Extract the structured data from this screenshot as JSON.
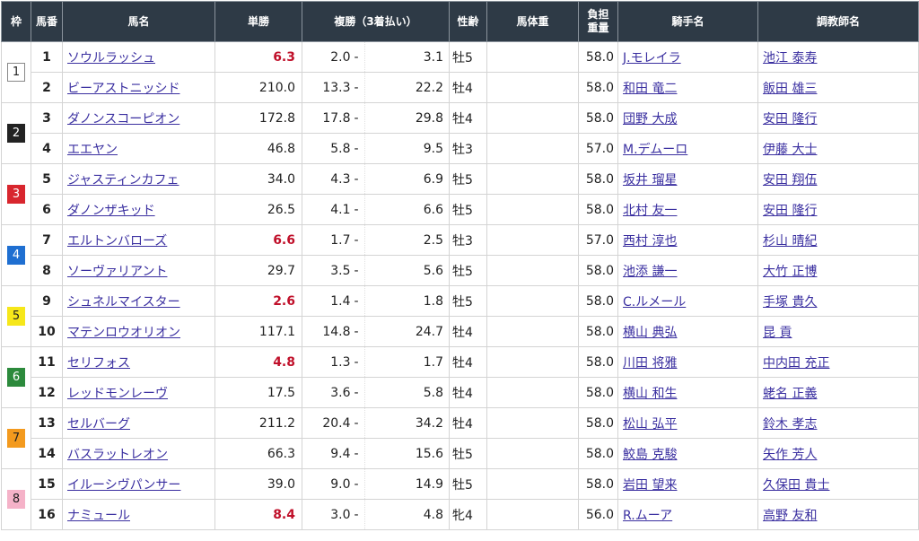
{
  "headers": {
    "waku": "枠",
    "umaban": "馬番",
    "horse": "馬名",
    "tansho": "単勝",
    "fukusho": "複勝（3着払い）",
    "sex_age": "性齢",
    "body_weight": "馬体重",
    "burden_line1": "負担",
    "burden_line2": "重量",
    "jockey": "騎手名",
    "trainer": "調教師名"
  },
  "waku_colors": {
    "1": {
      "bg": "#ffffff",
      "fg": "#222222"
    },
    "2": {
      "bg": "#222222",
      "fg": "#ffffff"
    },
    "3": {
      "bg": "#d8262e",
      "fg": "#ffffff"
    },
    "4": {
      "bg": "#1f6fd1",
      "fg": "#ffffff"
    },
    "5": {
      "bg": "#f6e71a",
      "fg": "#222222"
    },
    "6": {
      "bg": "#2c8a3c",
      "fg": "#ffffff"
    },
    "7": {
      "bg": "#f39a1e",
      "fg": "#222222"
    },
    "8": {
      "bg": "#f5b2c8",
      "fg": "#222222"
    }
  },
  "favorite_color": "#c0102a",
  "link_color": "#3a2fa0",
  "rows": [
    {
      "waku": "1",
      "umaban": "1",
      "horse": "ソウルラッシュ",
      "tansho": "6.3",
      "fav": true,
      "fuku_lo": "2.0",
      "sep": "-",
      "fuku_hi": "3.1",
      "sex_age": "牡5",
      "body_weight": "",
      "burden": "58.0",
      "jockey": "J.モレイラ",
      "trainer": "池江 泰寿"
    },
    {
      "waku": "1",
      "umaban": "2",
      "horse": "ビーアストニッシド",
      "tansho": "210.0",
      "fav": false,
      "fuku_lo": "13.3",
      "sep": "-",
      "fuku_hi": "22.2",
      "sex_age": "牡4",
      "body_weight": "",
      "burden": "58.0",
      "jockey": "和田 竜二",
      "trainer": "飯田 雄三"
    },
    {
      "waku": "2",
      "umaban": "3",
      "horse": "ダノンスコーピオン",
      "tansho": "172.8",
      "fav": false,
      "fuku_lo": "17.8",
      "sep": "-",
      "fuku_hi": "29.8",
      "sex_age": "牡4",
      "body_weight": "",
      "burden": "58.0",
      "jockey": "団野 大成",
      "trainer": "安田 隆行"
    },
    {
      "waku": "2",
      "umaban": "4",
      "horse": "エエヤン",
      "tansho": "46.8",
      "fav": false,
      "fuku_lo": "5.8",
      "sep": "-",
      "fuku_hi": "9.5",
      "sex_age": "牡3",
      "body_weight": "",
      "burden": "57.0",
      "jockey": "M.デムーロ",
      "trainer": "伊藤 大士"
    },
    {
      "waku": "3",
      "umaban": "5",
      "horse": "ジャスティンカフェ",
      "tansho": "34.0",
      "fav": false,
      "fuku_lo": "4.3",
      "sep": "-",
      "fuku_hi": "6.9",
      "sex_age": "牡5",
      "body_weight": "",
      "burden": "58.0",
      "jockey": "坂井 瑠星",
      "trainer": "安田 翔伍"
    },
    {
      "waku": "3",
      "umaban": "6",
      "horse": "ダノンザキッド",
      "tansho": "26.5",
      "fav": false,
      "fuku_lo": "4.1",
      "sep": "-",
      "fuku_hi": "6.6",
      "sex_age": "牡5",
      "body_weight": "",
      "burden": "58.0",
      "jockey": "北村 友一",
      "trainer": "安田 隆行"
    },
    {
      "waku": "4",
      "umaban": "7",
      "horse": "エルトンバローズ",
      "tansho": "6.6",
      "fav": true,
      "fuku_lo": "1.7",
      "sep": "-",
      "fuku_hi": "2.5",
      "sex_age": "牡3",
      "body_weight": "",
      "burden": "57.0",
      "jockey": "西村 淳也",
      "trainer": "杉山 晴紀"
    },
    {
      "waku": "4",
      "umaban": "8",
      "horse": "ソーヴァリアント",
      "tansho": "29.7",
      "fav": false,
      "fuku_lo": "3.5",
      "sep": "-",
      "fuku_hi": "5.6",
      "sex_age": "牡5",
      "body_weight": "",
      "burden": "58.0",
      "jockey": "池添 謙一",
      "trainer": "大竹 正博"
    },
    {
      "waku": "5",
      "umaban": "9",
      "horse": "シュネルマイスター",
      "tansho": "2.6",
      "fav": true,
      "fuku_lo": "1.4",
      "sep": "-",
      "fuku_hi": "1.8",
      "sex_age": "牡5",
      "body_weight": "",
      "burden": "58.0",
      "jockey": "C.ルメール",
      "trainer": "手塚 貴久"
    },
    {
      "waku": "5",
      "umaban": "10",
      "horse": "マテンロウオリオン",
      "tansho": "117.1",
      "fav": false,
      "fuku_lo": "14.8",
      "sep": "-",
      "fuku_hi": "24.7",
      "sex_age": "牡4",
      "body_weight": "",
      "burden": "58.0",
      "jockey": "横山 典弘",
      "trainer": "昆 貢"
    },
    {
      "waku": "6",
      "umaban": "11",
      "horse": "セリフォス",
      "tansho": "4.8",
      "fav": true,
      "fuku_lo": "1.3",
      "sep": "-",
      "fuku_hi": "1.7",
      "sex_age": "牡4",
      "body_weight": "",
      "burden": "58.0",
      "jockey": "川田 将雅",
      "trainer": "中内田 充正"
    },
    {
      "waku": "6",
      "umaban": "12",
      "horse": "レッドモンレーヴ",
      "tansho": "17.5",
      "fav": false,
      "fuku_lo": "3.6",
      "sep": "-",
      "fuku_hi": "5.8",
      "sex_age": "牡4",
      "body_weight": "",
      "burden": "58.0",
      "jockey": "横山 和生",
      "trainer": "蛯名 正義"
    },
    {
      "waku": "7",
      "umaban": "13",
      "horse": "セルバーグ",
      "tansho": "211.2",
      "fav": false,
      "fuku_lo": "20.4",
      "sep": "-",
      "fuku_hi": "34.2",
      "sex_age": "牡4",
      "body_weight": "",
      "burden": "58.0",
      "jockey": "松山 弘平",
      "trainer": "鈴木 孝志"
    },
    {
      "waku": "7",
      "umaban": "14",
      "horse": "バスラットレオン",
      "tansho": "66.3",
      "fav": false,
      "fuku_lo": "9.4",
      "sep": "-",
      "fuku_hi": "15.6",
      "sex_age": "牡5",
      "body_weight": "",
      "burden": "58.0",
      "jockey": "鮫島 克駿",
      "trainer": "矢作 芳人"
    },
    {
      "waku": "8",
      "umaban": "15",
      "horse": "イルーシヴパンサー",
      "tansho": "39.0",
      "fav": false,
      "fuku_lo": "9.0",
      "sep": "-",
      "fuku_hi": "14.9",
      "sex_age": "牡5",
      "body_weight": "",
      "burden": "58.0",
      "jockey": "岩田 望来",
      "trainer": "久保田 貴士"
    },
    {
      "waku": "8",
      "umaban": "16",
      "horse": "ナミュール",
      "tansho": "8.4",
      "fav": true,
      "fuku_lo": "3.0",
      "sep": "-",
      "fuku_hi": "4.8",
      "sex_age": "牝4",
      "body_weight": "",
      "burden": "56.0",
      "jockey": "R.ムーア",
      "trainer": "高野 友和"
    }
  ]
}
